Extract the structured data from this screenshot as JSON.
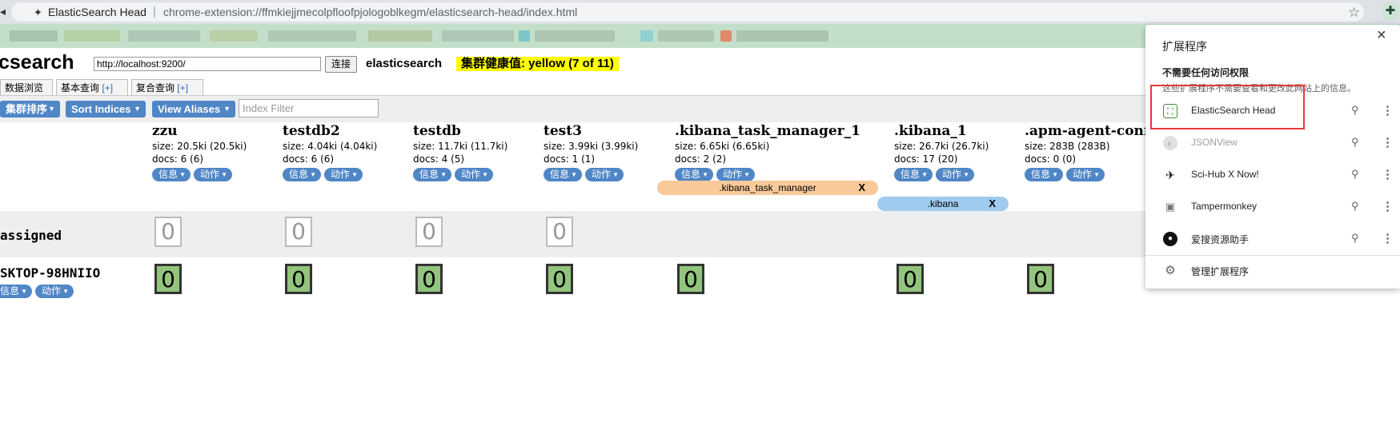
{
  "browser": {
    "tab_title": "ElasticSearch Head",
    "url_path": "chrome-extension://ffmkiejjmecolpfloofpjologoblkegm/elasticsearch-head/index.html",
    "separator": "|"
  },
  "head": {
    "app_title": "csearch",
    "url_value": "http://localhost:9200/",
    "connect_label": "连接",
    "cluster_name": "elasticsearch",
    "health": "集群健康值: yellow (7 of 11)",
    "tabs": [
      {
        "label": "数据浏览",
        "plus": ""
      },
      {
        "label": "基本查询",
        "plus": "[+]"
      },
      {
        "label": "复合查询",
        "plus": "[+]"
      }
    ],
    "toolbar": {
      "sort_cluster": "集群排序",
      "sort_indices": "Sort Indices",
      "view_aliases": "View Aliases",
      "filter_placeholder": "Index Filter"
    },
    "pill_info": "信息",
    "pill_action": "动作",
    "indices": [
      {
        "name": "zzu",
        "size": "size: 20.5ki (20.5ki)",
        "docs": "docs: 6 (6)"
      },
      {
        "name": "testdb2",
        "size": "size: 4.04ki (4.04ki)",
        "docs": "docs: 6 (6)"
      },
      {
        "name": "testdb",
        "size": "size: 11.7ki (11.7ki)",
        "docs": "docs: 4 (5)"
      },
      {
        "name": "test3",
        "size": "size: 3.99ki (3.99ki)",
        "docs": "docs: 1 (1)"
      },
      {
        "name": ".kibana_task_manager_1",
        "size": "size: 6.65ki (6.65ki)",
        "docs": "docs: 2 (2)"
      },
      {
        "name": ".kibana_1",
        "size": "size: 26.7ki (26.7ki)",
        "docs": "docs: 17 (20)"
      },
      {
        "name": ".apm-agent-confi",
        "size": "size: 283B (283B)",
        "docs": "docs: 0 (0)"
      }
    ],
    "aliases": [
      {
        "label": ".kibana_task_manager",
        "x": "X",
        "color": "#f9c99a"
      },
      {
        "label": ".kibana",
        "x": "X",
        "color": "#9fcbee"
      }
    ],
    "rows": {
      "unassigned_label": "assigned",
      "node_label": "SKTOP-98HNIIO"
    },
    "shard_value": "0",
    "colors": {
      "accent": "#4f86c6",
      "health_yellow": "#ffff00",
      "shard_green": "#93c47d",
      "band_gray": "#eeeeee"
    }
  },
  "popup": {
    "title": "扩展程序",
    "close": "×",
    "sub": "不需要任何访问权限",
    "desc": "这些扩展程序不需要查看和更改此网站上的信息。",
    "extensions": [
      {
        "name": "ElasticSearch Head",
        "icon": "elasticsearch-head-icon",
        "disabled": false
      },
      {
        "name": "JSONView",
        "icon": "jsonview-icon",
        "disabled": true
      },
      {
        "name": "Sci-Hub X Now!",
        "icon": "scihub-icon",
        "disabled": false
      },
      {
        "name": "Tampermonkey",
        "icon": "tampermonkey-icon",
        "disabled": false
      },
      {
        "name": "爱搜资源助手",
        "icon": "aisou-icon",
        "disabled": false
      }
    ],
    "manage": "管理扩展程序"
  }
}
